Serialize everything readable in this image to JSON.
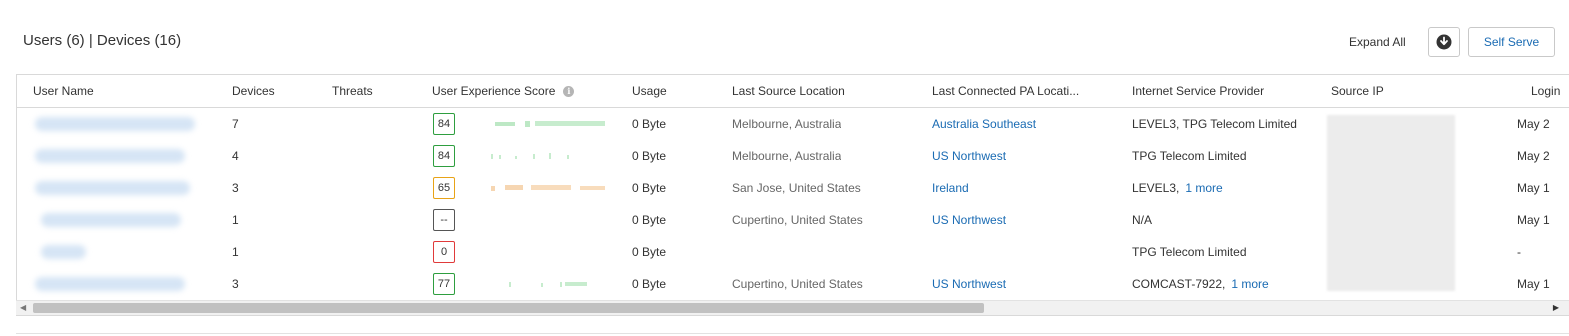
{
  "header": {
    "users_label": "Users (6)",
    "separator": "|",
    "devices_label": "Devices (16)",
    "expand_all": "Expand All",
    "self_serve": "Self Serve"
  },
  "icons": {
    "download": "download-circle-icon",
    "info": "info-icon",
    "scroll_left": "chevron-left-icon",
    "scroll_right": "chevron-right-icon"
  },
  "colors": {
    "link": "#1a6bb3",
    "score_good": "#2e9e3f",
    "score_fair": "#e8a317",
    "score_poor": "#e03a3a",
    "score_none": "#555555"
  },
  "table": {
    "columns": {
      "user_name": "User Name",
      "devices": "Devices",
      "threats": "Threats",
      "ux_score": "User Experience Score",
      "usage": "Usage",
      "last_source_location": "Last Source Location",
      "last_connected_pa": "Last Connected PA Locati...",
      "isp": "Internet Service Provider",
      "source_ip": "Source IP",
      "login": "Login"
    },
    "rows": [
      {
        "devices": "7",
        "threats": "",
        "score": "84",
        "score_status": "green",
        "usage": "0 Byte",
        "location": "Melbourne, Australia",
        "pa_location": "Australia Southeast",
        "isp": "LEVEL3, TPG Telecom Limited",
        "isp_more": "",
        "login": "May 2"
      },
      {
        "devices": "4",
        "threats": "",
        "score": "84",
        "score_status": "green",
        "usage": "0 Byte",
        "location": "Melbourne, Australia",
        "pa_location": "US Northwest",
        "isp": "TPG Telecom Limited",
        "isp_more": "",
        "login": "May 2"
      },
      {
        "devices": "3",
        "threats": "",
        "score": "65",
        "score_status": "orange",
        "usage": "0 Byte",
        "location": "San Jose, United States",
        "pa_location": "Ireland",
        "isp": "LEVEL3,",
        "isp_more": "1 more",
        "login": "May 1"
      },
      {
        "devices": "1",
        "threats": "",
        "score": "--",
        "score_status": "gray",
        "usage": "0 Byte",
        "location": "Cupertino, United States",
        "pa_location": "US Northwest",
        "isp": "N/A",
        "isp_more": "",
        "login": "May 1"
      },
      {
        "devices": "1",
        "threats": "",
        "score": "0",
        "score_status": "red",
        "usage": "0 Byte",
        "location": "",
        "pa_location": "",
        "isp": "TPG Telecom Limited",
        "isp_more": "",
        "login": "-"
      },
      {
        "devices": "3",
        "threats": "",
        "score": "77",
        "score_status": "green",
        "usage": "0 Byte",
        "location": "Cupertino, United States",
        "pa_location": "US Northwest",
        "isp": "COMCAST-7922,",
        "isp_more": "1 more",
        "login": "May 1"
      }
    ]
  }
}
